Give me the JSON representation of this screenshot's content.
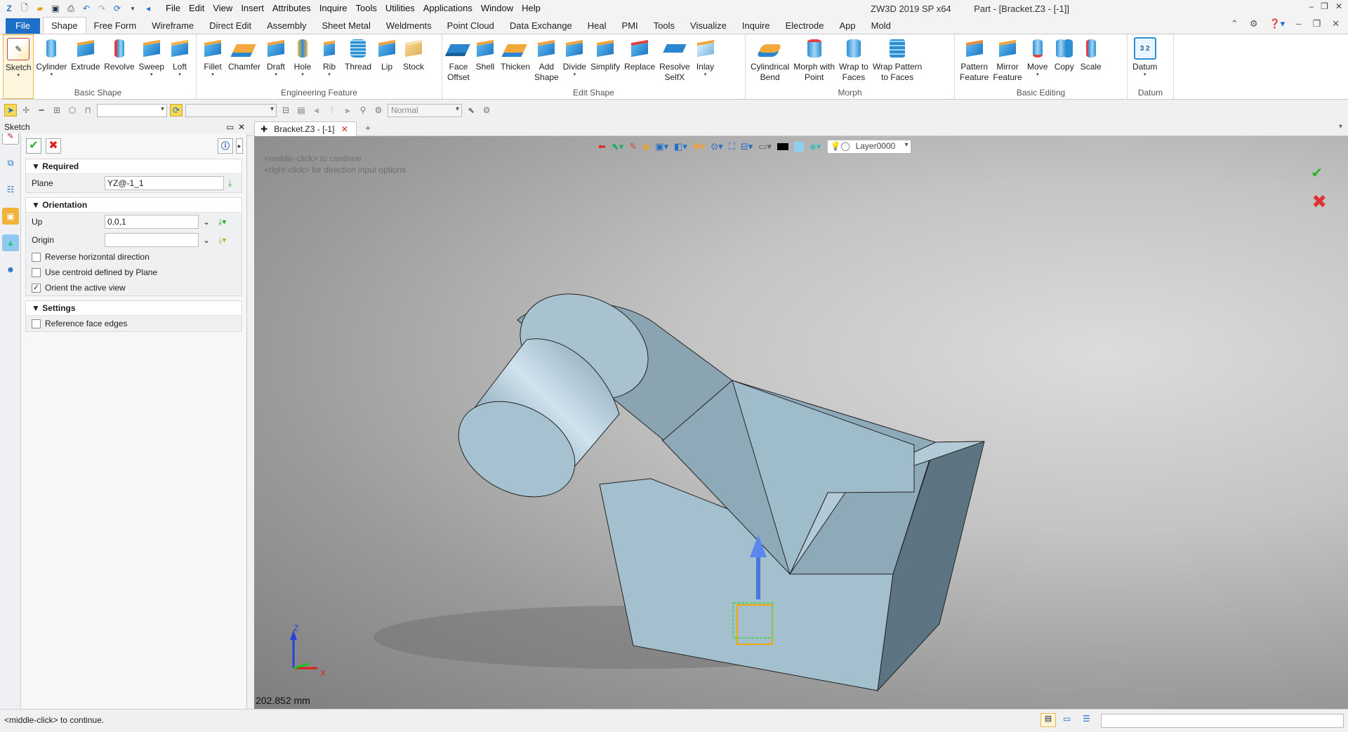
{
  "app": {
    "window_title": "ZW3D 2019 SP x64",
    "doc_title": "Part - [Bracket.Z3 - [-1]]"
  },
  "menu": [
    "File",
    "Edit",
    "View",
    "Insert",
    "Attributes",
    "Inquire",
    "Tools",
    "Utilities",
    "Applications",
    "Window",
    "Help"
  ],
  "ribbon_tabs": [
    "File",
    "Shape",
    "Free Form",
    "Wireframe",
    "Direct Edit",
    "Assembly",
    "Sheet Metal",
    "Weldments",
    "Point Cloud",
    "Data Exchange",
    "Heal",
    "PMI",
    "Tools",
    "Visualize",
    "Inquire",
    "Electrode",
    "App",
    "Mold"
  ],
  "active_tab": "Shape",
  "groups": {
    "basic_shape": {
      "name": "Basic Shape",
      "buttons": [
        "Sketch",
        "Cylinder",
        "Extrude",
        "Revolve",
        "Sweep",
        "Loft"
      ]
    },
    "engineering": {
      "name": "Engineering Feature",
      "buttons": [
        "Fillet",
        "Chamfer",
        "Draft",
        "Hole",
        "Rib",
        "Thread",
        "Lip",
        "Stock"
      ]
    },
    "edit_shape": {
      "name": "Edit Shape",
      "buttons": [
        "Face\nOffset",
        "Shell",
        "Thicken",
        "Add\nShape",
        "Divide",
        "Simplify",
        "Replace",
        "Resolve\nSelfX",
        "Inlay"
      ]
    },
    "morph": {
      "name": "Morph",
      "buttons": [
        "Cylindrical\nBend",
        "Morph with\nPoint",
        "Wrap to\nFaces",
        "Wrap Pattern\nto Faces"
      ]
    },
    "basic_editing": {
      "name": "Basic Editing",
      "buttons": [
        "Pattern\nFeature",
        "Mirror\nFeature",
        "Move",
        "Copy",
        "Scale"
      ]
    },
    "datum": {
      "name": "Datum",
      "buttons": [
        "Datum"
      ]
    }
  },
  "toolbar2": {
    "render_mode": "Normal"
  },
  "panel": {
    "title": "Sketch",
    "required": {
      "header": "Required",
      "plane_label": "Plane",
      "plane_value": "YZ@-1_1"
    },
    "orientation": {
      "header": "Orientation",
      "up_label": "Up",
      "up_value": "0,0,1",
      "origin_label": "Origin",
      "origin_value": "",
      "reverse": "Reverse horizontal direction",
      "centroid": "Use centroid defined by Plane",
      "orient": "Orient the active view"
    },
    "settings": {
      "header": "Settings",
      "ref": "Reference face edges"
    }
  },
  "doc_tab": "Bracket.Z3 - [-1]",
  "viewport": {
    "hint1": "<middle-click> to continue",
    "hint2": "<right-click> for direction input options",
    "layer": "Layer0000",
    "scale_readout": "202.852 mm",
    "axis_z": "Z",
    "axis_x": "X"
  },
  "status": {
    "text": "<middle-click> to continue."
  },
  "colors": {
    "accent": "#1e6fc8",
    "ok": "#2bb22b",
    "cancel": "#d22"
  }
}
